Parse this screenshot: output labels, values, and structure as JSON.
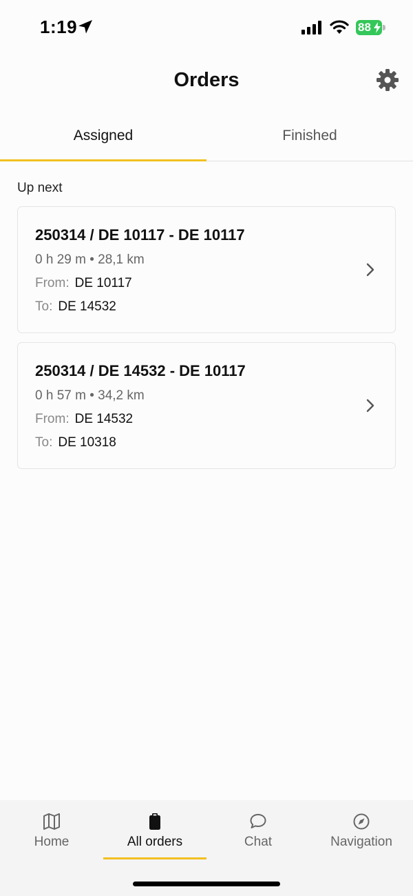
{
  "status_bar": {
    "time": "1:19",
    "battery": "88",
    "battery_color": "#34c759"
  },
  "header": {
    "title": "Orders",
    "settings_icon": "gear-icon"
  },
  "tabs": [
    {
      "label": "Assigned",
      "active": true
    },
    {
      "label": "Finished",
      "active": false
    }
  ],
  "accent_color": "#f2c01f",
  "section_label": "Up next",
  "orders": [
    {
      "title": "250314 / DE 10117 - DE 10117",
      "meta": "0 h 29 m • 28,1 km",
      "from_label": "From:",
      "from_value": "DE 10117",
      "to_label": "To:",
      "to_value": "DE 14532"
    },
    {
      "title": "250314 / DE 14532 - DE 10117",
      "meta": "0 h 57 m • 34,2 km",
      "from_label": "From:",
      "from_value": "DE 14532",
      "to_label": "To:",
      "to_value": "DE 10318"
    }
  ],
  "bottom_nav": [
    {
      "label": "Home",
      "icon": "map-icon",
      "active": false
    },
    {
      "label": "All orders",
      "icon": "clipboard-icon",
      "active": true
    },
    {
      "label": "Chat",
      "icon": "chat-bubble-icon",
      "active": false
    },
    {
      "label": "Navigation",
      "icon": "compass-icon",
      "active": false
    }
  ]
}
